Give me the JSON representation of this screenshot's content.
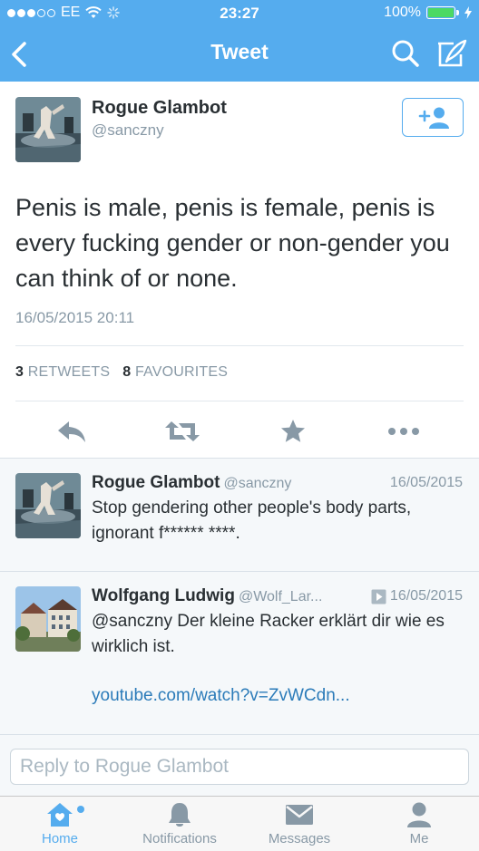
{
  "status_bar": {
    "carrier": "EE",
    "time": "23:27",
    "battery": "100%",
    "battery_level": 1.0
  },
  "nav": {
    "title": "Tweet",
    "icons": [
      "back-chevron-icon",
      "search-icon",
      "compose-icon"
    ]
  },
  "tweet": {
    "author_name": "Rogue Glambot",
    "author_handle": "@sanczny",
    "text": "Penis is male, penis is female, penis is every fucking gender or non-gender you can think of or none.",
    "timestamp": "16/05/2015 20:11",
    "retweets_count": "3",
    "retweets_label": "RETWEETS",
    "favourites_count": "8",
    "favourites_label": "FAVOURITES"
  },
  "replies": [
    {
      "name": "Rogue Glambot",
      "handle": "@sanczny",
      "date": "16/05/2015",
      "text": "Stop gendering other people's body parts, ignorant f****** ****."
    },
    {
      "name": "Wolfgang Ludwig",
      "handle": "@Wolf_Lar...",
      "date": "16/05/2015",
      "text": "@sanczny Der kleine Racker erklärt dir wie es wirklich ist.",
      "link": "youtube.com/watch?v=ZvWCdn..."
    }
  ],
  "reply_box": {
    "placeholder": "Reply to Rogue Glambot"
  },
  "tabs": [
    {
      "label": "Home",
      "icon": "home-icon",
      "active": true
    },
    {
      "label": "Notifications",
      "icon": "bell-icon",
      "active": false
    },
    {
      "label": "Messages",
      "icon": "envelope-icon",
      "active": false
    },
    {
      "label": "Me",
      "icon": "person-icon",
      "active": false
    }
  ],
  "colors": {
    "brand_blue": "#55acee",
    "link_blue": "#2b7bb9",
    "muted_gray": "#8899a6",
    "text_dark": "#292f33"
  }
}
